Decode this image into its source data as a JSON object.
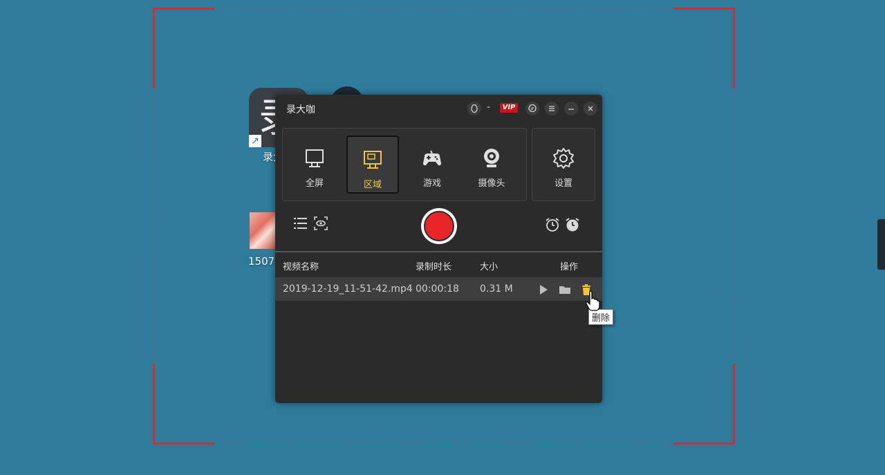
{
  "desktop": {
    "app_icon_char": "录",
    "app_icon_label": "录大",
    "photo_label": "1507"
  },
  "window": {
    "title": "录大咖",
    "title_buttons": {
      "dash": "-",
      "vip": "VIP"
    }
  },
  "modes": [
    {
      "label": "全屏",
      "icon": "monitor-icon"
    },
    {
      "label": "区域",
      "icon": "region-icon",
      "active": true
    },
    {
      "label": "游戏",
      "icon": "gamepad-icon"
    },
    {
      "label": "摄像头",
      "icon": "webcam-icon"
    }
  ],
  "settings": {
    "label": "设置",
    "icon": "gear-icon"
  },
  "list": {
    "headers": {
      "name": "视频名称",
      "duration": "录制时长",
      "size": "大小",
      "actions": "操作"
    },
    "rows": [
      {
        "name": "2019-12-19_11-51-42.mp4",
        "duration": "00:00:18",
        "size": "0.31 M"
      }
    ]
  },
  "tooltip": "删除",
  "colors": {
    "desktop_bg": "#2f7b9c",
    "window_bg": "#2b2b2b",
    "accent_active": "#f4c63c",
    "record_red": "#e8262a",
    "region_corner": "#c8313c",
    "vip_red": "#c8161d"
  }
}
